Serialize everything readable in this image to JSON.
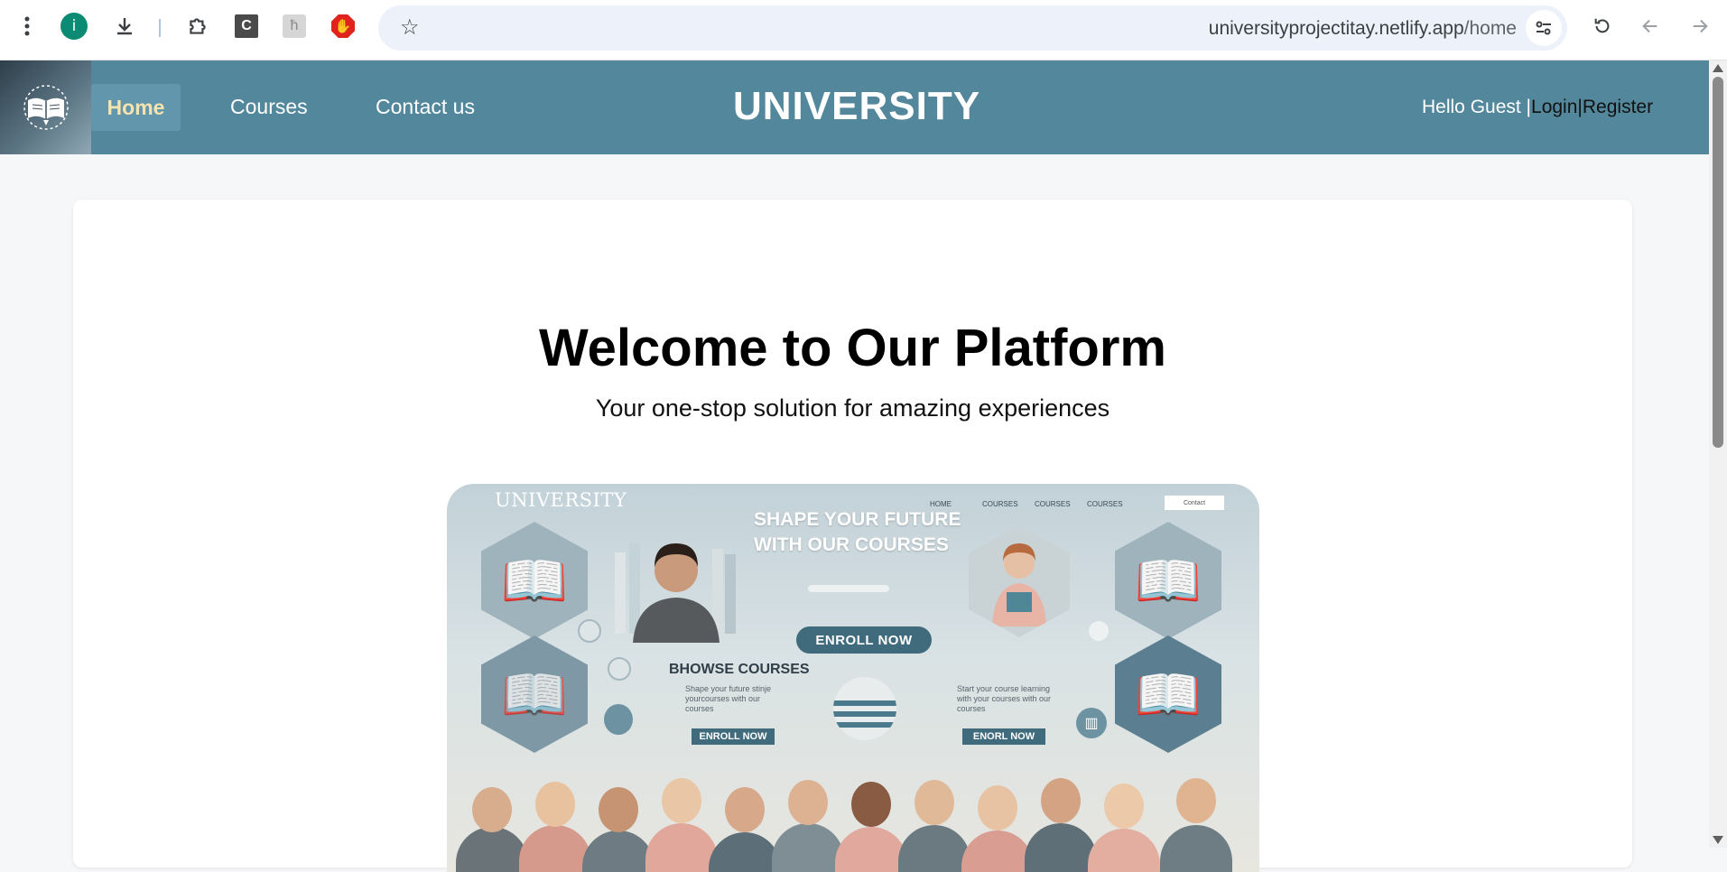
{
  "browser": {
    "url_host": "universityprojectitay.netlify.app",
    "url_path": "/home",
    "icons": [
      "more-vert-icon",
      "extension-i-icon",
      "download-icon",
      "puzzle-icon",
      "extension-c-icon",
      "extension-h-icon",
      "stop-hand-icon",
      "star-icon",
      "tune-icon",
      "reload-icon",
      "back-arrow-icon",
      "forward-arrow-icon"
    ],
    "ext_i_label": "i",
    "ext_c_label": "C",
    "ext_h_label": "ћ"
  },
  "header": {
    "nav": {
      "home": "Home",
      "courses": "Courses",
      "contact": "Contact us"
    },
    "brand": "UNIVERSITY",
    "greeting": "Hello Guest |",
    "login": "Login",
    "separator": "|",
    "register": "Register",
    "colors": {
      "bar": "#53889c",
      "active_tab": "#6196ad",
      "active_text": "#f6e3ae"
    }
  },
  "hero": {
    "title": "Welcome to Our Platform",
    "subtitle": "Your one-stop solution for amazing experiences"
  },
  "hero_image": {
    "brand": "UNIVERSITY",
    "nav": [
      "HOME",
      "COURSES",
      "COURSES",
      "COURSES"
    ],
    "small_button": "Contact",
    "headline_1": "SHAPE YOUR FUTURE",
    "headline_2": "WITH OUR COURSES",
    "enroll_main": "ENROLL NOW",
    "browse": "BHOWSE COURSES",
    "left_text": "Shape your future stinje yourcourses with our courses",
    "right_text": "Start your course learning with your courses with our courses",
    "enroll_left": "ENROLL NOW",
    "enroll_right": "ENORL NOW"
  }
}
